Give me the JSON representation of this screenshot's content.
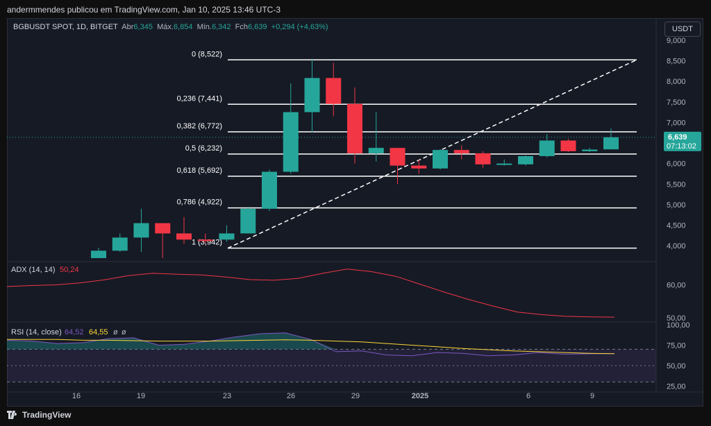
{
  "header": {
    "attribution": "andermmendes publicou em TradingView.com, Jan 10, 2025 13:46 UTC-3"
  },
  "symbol_bar": {
    "symbol": "BGBUSDT SPOT, 1D, BITGET",
    "open_label": "Abr",
    "open_value": "6,345",
    "high_label": "Máx.",
    "high_value": "6,854",
    "low_label": "Mín.",
    "low_value": "6,342",
    "close_label": "Fch",
    "close_value": "6,639",
    "change": "+0,294 (+4,63%)"
  },
  "currency_button": "USDT",
  "price_badge": {
    "price": "6,639",
    "countdown": "07:13:02"
  },
  "colors": {
    "up": "#26a69a",
    "down": "#f23645",
    "adx": "#f23645",
    "rsi": "#7e57c2",
    "rsi_ma": "#fdd835",
    "fib": "#ffffff"
  },
  "chart_data": [
    {
      "type": "candlestick",
      "x_ticks": [
        "16",
        "19",
        "23",
        "26",
        "29",
        "2025",
        "6",
        "9"
      ],
      "y_ticks": [
        "4,000",
        "4,500",
        "5,000",
        "5,500",
        "6,000",
        "6,500",
        "7,000",
        "7,500",
        "8,000",
        "8,500",
        "9,000"
      ],
      "ylim": [
        3700,
        9100
      ],
      "candles": [
        {
          "o": 3500,
          "h": 3950,
          "l": 3400,
          "c": 3880
        },
        {
          "o": 3880,
          "h": 4300,
          "l": 3850,
          "c": 4200
        },
        {
          "o": 4200,
          "h": 4900,
          "l": 3850,
          "c": 4550
        },
        {
          "o": 4550,
          "h": 4550,
          "l": 3700,
          "c": 4300
        },
        {
          "o": 4300,
          "h": 4700,
          "l": 4050,
          "c": 4150
        },
        {
          "o": 4150,
          "h": 4300,
          "l": 4050,
          "c": 4140
        },
        {
          "o": 4150,
          "h": 4500,
          "l": 4100,
          "c": 4300
        },
        {
          "o": 4300,
          "h": 4950,
          "l": 4300,
          "c": 4900
        },
        {
          "o": 4900,
          "h": 5850,
          "l": 4850,
          "c": 5800
        },
        {
          "o": 5800,
          "h": 7950,
          "l": 5750,
          "c": 7250
        },
        {
          "o": 7250,
          "h": 8550,
          "l": 6750,
          "c": 8080
        },
        {
          "o": 8080,
          "h": 8450,
          "l": 7150,
          "c": 7450
        },
        {
          "o": 7450,
          "h": 7850,
          "l": 6000,
          "c": 6250
        },
        {
          "o": 6250,
          "h": 7250,
          "l": 6050,
          "c": 6380
        },
        {
          "o": 6380,
          "h": 6380,
          "l": 5500,
          "c": 5950
        },
        {
          "o": 5950,
          "h": 6100,
          "l": 5750,
          "c": 5880
        },
        {
          "o": 5880,
          "h": 6350,
          "l": 5850,
          "c": 6330
        },
        {
          "o": 6330,
          "h": 6450,
          "l": 6100,
          "c": 6250
        },
        {
          "o": 6250,
          "h": 6300,
          "l": 5900,
          "c": 5980
        },
        {
          "o": 5980,
          "h": 6100,
          "l": 5950,
          "c": 6000
        },
        {
          "o": 5980,
          "h": 6200,
          "l": 5950,
          "c": 6180
        },
        {
          "o": 6180,
          "h": 6720,
          "l": 6150,
          "c": 6560
        },
        {
          "o": 6560,
          "h": 6600,
          "l": 6280,
          "c": 6300
        },
        {
          "o": 6300,
          "h": 6380,
          "l": 6280,
          "c": 6340
        },
        {
          "o": 6345,
          "h": 6854,
          "l": 6342,
          "c": 6639
        }
      ],
      "fib_levels": [
        {
          "label": "0 (8,522)",
          "value": 8522
        },
        {
          "label": "0,236 (7,441)",
          "value": 7441
        },
        {
          "label": "0,382 (6,772)",
          "value": 6772
        },
        {
          "label": "0,5 (6,232)",
          "value": 6232
        },
        {
          "label": "0,618 (5,692)",
          "value": 5692
        },
        {
          "label": "0,786 (4,922)",
          "value": 4922
        },
        {
          "label": "1 (3,942)",
          "value": 3942
        }
      ]
    },
    {
      "type": "line",
      "title": "ADX (14, 14)",
      "value_label": "50,24",
      "y_ticks": [
        "50,00",
        "60,00"
      ],
      "ylim": [
        49,
        66
      ],
      "values": [
        59.5,
        59.8,
        60.0,
        60.6,
        61.5,
        62.8,
        63.5,
        63.2,
        63.0,
        62.4,
        61.6,
        61.4,
        62.0,
        63.5,
        64.8,
        64.0,
        62.6,
        60.2,
        57.8,
        55.6,
        53.6,
        51.8,
        51.0,
        50.5,
        50.3,
        50.24
      ]
    },
    {
      "type": "line",
      "title": "RSI (14, close)",
      "values_label": [
        "64,52",
        "64,55",
        "ø",
        "ø"
      ],
      "y_ticks": [
        "25,00",
        "50,00",
        "75,00",
        "100,00"
      ],
      "ylim": [
        22,
        100
      ],
      "rsi": [
        81,
        80,
        77,
        78,
        83,
        84,
        75,
        76,
        80,
        85,
        89,
        90,
        82,
        67,
        68,
        63,
        62,
        66,
        65,
        62,
        63,
        66,
        64,
        64.5,
        64.52
      ],
      "rsi_ma": [
        82,
        82,
        82,
        81,
        81,
        80.5,
        80,
        80,
        80,
        80.5,
        81,
        81.5,
        81,
        80,
        79,
        77,
        75,
        73,
        71,
        69.5,
        68,
        67,
        66,
        65,
        64.55
      ]
    }
  ]
}
